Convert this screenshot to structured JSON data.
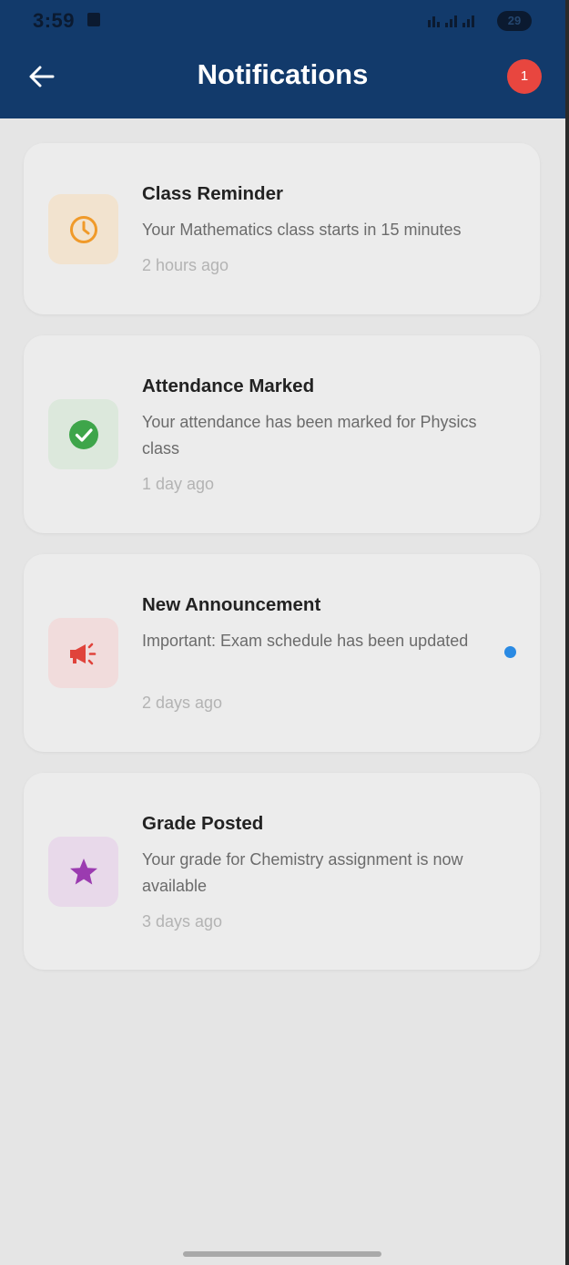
{
  "status_bar": {
    "time": "3:59",
    "battery": "29"
  },
  "header": {
    "title": "Notifications",
    "badge_count": "1"
  },
  "notifications": [
    {
      "title": "Class Reminder",
      "message": "Your Mathematics class starts in 15 minutes",
      "time": "2 hours ago",
      "icon": "clock-icon",
      "icon_color": "#f09a2a",
      "tile_color": "#f2e3cf",
      "unread": false
    },
    {
      "title": "Attendance Marked",
      "message": "Your attendance has been marked for Physics class",
      "time": "1 day ago",
      "icon": "check-circle-icon",
      "icon_color": "#3ea54a",
      "tile_color": "#dce8dc",
      "unread": false
    },
    {
      "title": "New Announcement",
      "message": "Important: Exam schedule has been updated",
      "time": "2 days ago",
      "icon": "megaphone-icon",
      "icon_color": "#e0433b",
      "tile_color": "#f1dcdc",
      "unread": true
    },
    {
      "title": "Grade Posted",
      "message": "Your grade for Chemistry assignment is now available",
      "time": "3 days ago",
      "icon": "star-icon",
      "icon_color": "#9b3bb0",
      "tile_color": "#e8d9ea",
      "unread": false
    }
  ],
  "colors": {
    "header_bg": "#123a6b",
    "badge_bg": "#e8463f",
    "unread_dot": "#2a8ae3",
    "page_bg": "#e5e5e5"
  }
}
